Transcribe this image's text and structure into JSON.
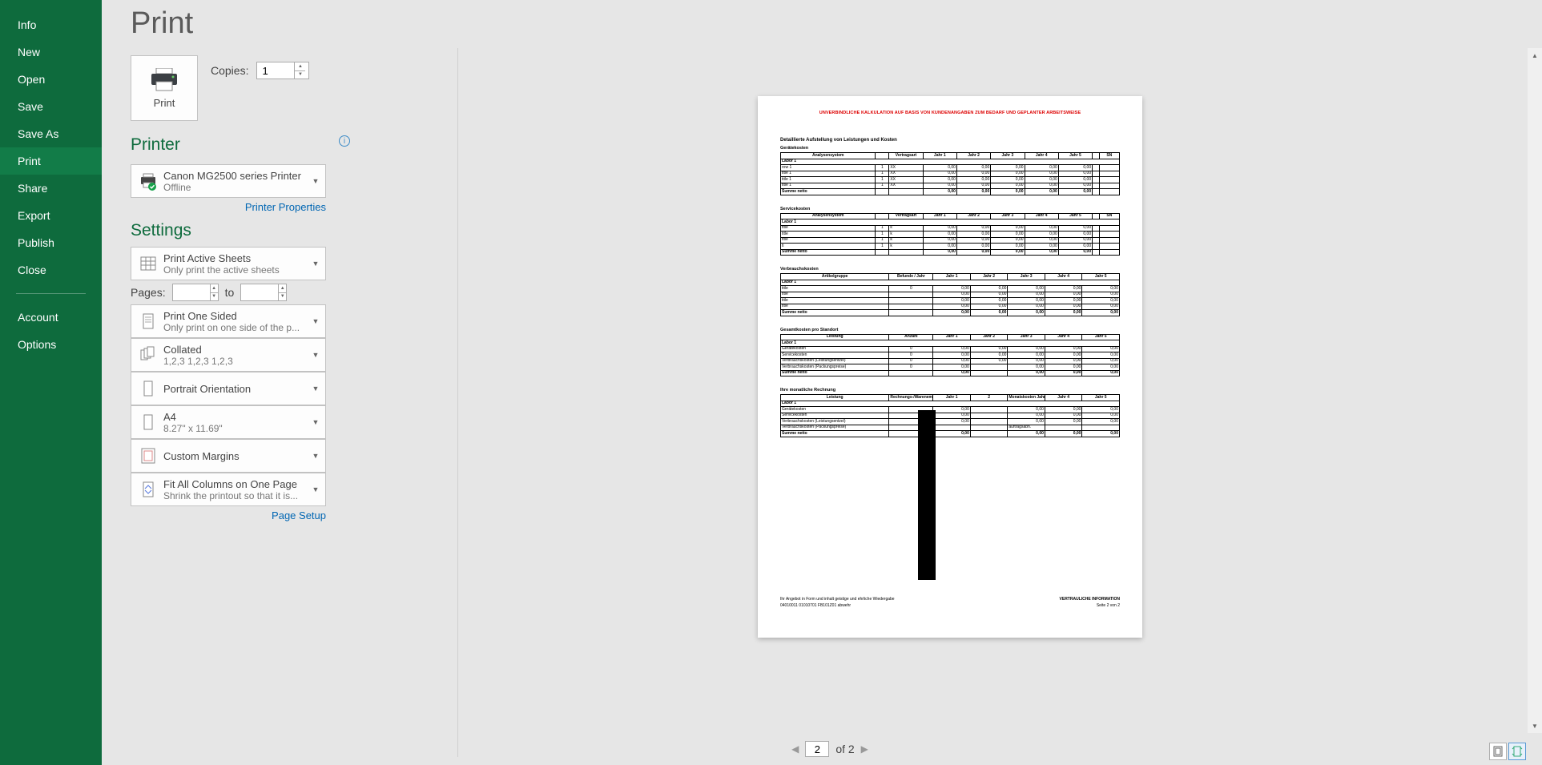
{
  "sidebar": {
    "items": [
      {
        "label": "Info"
      },
      {
        "label": "New"
      },
      {
        "label": "Open"
      },
      {
        "label": "Save"
      },
      {
        "label": "Save As"
      },
      {
        "label": "Print"
      },
      {
        "label": "Share"
      },
      {
        "label": "Export"
      },
      {
        "label": "Publish"
      },
      {
        "label": "Close"
      }
    ],
    "footer": [
      {
        "label": "Account"
      },
      {
        "label": "Options"
      }
    ]
  },
  "page_title": "Print",
  "print_button": "Print",
  "copies_label": "Copies:",
  "copies_value": "1",
  "printer_section": "Printer",
  "printer_name": "Canon MG2500 series Printer",
  "printer_status": "Offline",
  "printer_properties": "Printer Properties",
  "settings_section": "Settings",
  "settings": {
    "what": {
      "line1": "Print Active Sheets",
      "line2": "Only print the active sheets"
    },
    "pages_label": "Pages:",
    "pages_to": "to",
    "pages_from": "",
    "pages_to_val": "",
    "sided": {
      "line1": "Print One Sided",
      "line2": "Only print on one side of the p..."
    },
    "collate": {
      "line1": "Collated",
      "line2": "1,2,3    1,2,3    1,2,3"
    },
    "orientation": {
      "line1": "Portrait Orientation",
      "line2": ""
    },
    "paper": {
      "line1": "A4",
      "line2": "8.27\" x 11.69\""
    },
    "margins": {
      "line1": "Custom Margins",
      "line2": ""
    },
    "scaling": {
      "line1": "Fit All Columns on One Page",
      "line2": "Shrink the printout so that it is..."
    }
  },
  "page_setup": "Page Setup",
  "nav": {
    "current": "2",
    "total": "of 2"
  },
  "chart_data": {
    "type": "table",
    "title_red": "UNVERBINDLICHE KALKULATION AUF BASIS VON KUNDENANGABEN ZUM BEDARF UND GEPLANTER ARBEITSWEISE",
    "heading": "Detaillierte Aufstellung von Leistungen und Kosten",
    "sections": [
      {
        "name": "Gerätekosten",
        "columns": [
          "Analysensystem",
          "",
          "Vertragsart",
          "Jahr 1",
          "Jahr 2",
          "Jahr 3",
          "Jahr 4",
          "Jahr 5",
          "",
          "SN"
        ],
        "group": "Labor 1",
        "rows": [
          [
            "row 1",
            "1",
            "XX",
            "0,00",
            "0,00",
            "0,00",
            "0,00",
            "0,00",
            "",
            ""
          ],
          [
            "title 1",
            "1",
            "XX",
            "0,00",
            "0,00",
            "0,00",
            "0,00",
            "0,00",
            "",
            ""
          ],
          [
            "title 1",
            "1",
            "XX",
            "0,00",
            "0,00",
            "0,00",
            "0,00",
            "0,00",
            "",
            ""
          ],
          [
            "title 1",
            "1",
            "XX",
            "0,00",
            "0,00",
            "0,00",
            "0,00",
            "0,00",
            "",
            ""
          ]
        ],
        "sum": [
          "Summe netto",
          "",
          "",
          "0,00",
          "0,00",
          "0,00",
          "0,00",
          "0,00",
          "",
          ""
        ]
      },
      {
        "name": "Servicekosten",
        "columns": [
          "Analysensystem",
          "",
          "Vertragsart",
          "Jahr 1",
          "Jahr 2",
          "Jahr 3",
          "Jahr 4",
          "Jahr 5",
          "",
          "SN"
        ],
        "group": "Labor 1",
        "rows": [
          [
            "title",
            "1",
            "k",
            "0,00",
            "0,00",
            "0,00",
            "0,00",
            "0,00",
            "",
            ""
          ],
          [
            "title",
            "1",
            "k",
            "0,00",
            "0,00",
            "0,00",
            "0,00",
            "0,00",
            "",
            ""
          ],
          [
            "title",
            "1",
            "k",
            "0,00",
            "0,00",
            "0,00",
            "0,00",
            "0,00",
            "",
            ""
          ],
          [
            "ti",
            "1",
            "k",
            "0,00",
            "0,00",
            "0,00",
            "0,00",
            "0,00",
            "",
            ""
          ]
        ],
        "sum": [
          "Summe netto",
          "",
          "",
          "0,00",
          "0,00",
          "0,00",
          "0,00",
          "0,00",
          "",
          ""
        ]
      },
      {
        "name": "Verbrauchskosten",
        "columns": [
          "Artikelgruppe",
          "Befunde / Jahr",
          "Jahr 1",
          "Jahr 2",
          "Jahr 3",
          "Jahr 4",
          "Jahr 5"
        ],
        "group": "Labor 1",
        "rows": [
          [
            "title",
            "0",
            "0,00",
            "0,00",
            "0,00",
            "0,00",
            "0,00"
          ],
          [
            "title",
            "",
            "0,00",
            "0,00",
            "0,00",
            "0,00",
            "0,00"
          ],
          [
            "title",
            "",
            "0,00",
            "0,00",
            "0,00",
            "0,00",
            "0,00"
          ],
          [
            "title",
            "",
            "0,00",
            "0,00",
            "0,00",
            "0,00",
            "0,00"
          ]
        ],
        "sum": [
          "Summe netto",
          "",
          "0,00",
          "0,00",
          "0,00",
          "0,00",
          "0,00"
        ]
      },
      {
        "name": "Gesamtkosten pro Standort",
        "columns": [
          "Leistung",
          "Anzahl",
          "Jahr 1",
          "Jahr 2",
          "Jahr 3",
          "Jahr 4",
          "Jahr 5"
        ],
        "group": "Labor 1",
        "rows": [
          [
            "Gerätekosten",
            "0",
            "0,00",
            "0,00",
            "0,00",
            "0,00",
            "0,00"
          ],
          [
            "Servicekosten",
            "0",
            "0,00",
            "0,00",
            "0,00",
            "0,00",
            "0,00"
          ],
          [
            "Verbrauchskosten (Leistungsentzel)",
            "0",
            "0,00",
            "0,00",
            "0,00",
            "0,00",
            "0,00"
          ],
          [
            "Verbrauchskosten (Packungspreise)",
            "0",
            "0,00",
            "",
            "0,00",
            "0,00",
            "0,00"
          ]
        ],
        "sum": [
          "Summe netto",
          "",
          "0,00",
          "",
          "0,00",
          "0,00",
          "0,00"
        ]
      },
      {
        "name": "Ihre monatliche Rechnung",
        "columns": [
          "Leistung",
          "Rechnungs-/Warenempfang",
          "Jahr 1",
          "2",
          "Monatskosten Jahr 3",
          "Jahr 4",
          "Jahr 5"
        ],
        "group": "Labor 1",
        "rows": [
          [
            "Gerätekosten",
            "",
            "0,00",
            "",
            "0,00",
            "0,00",
            "0,00"
          ],
          [
            "Servicekosten",
            "",
            "0,00",
            "",
            "0,00",
            "0,00",
            "0,00"
          ],
          [
            "Verbrauchskosten (Leistungsentzel)",
            "",
            "0,00",
            "",
            "0,00",
            "0,00",
            "0,00"
          ],
          [
            "Verbrauchskosten (Packungspreise)",
            "",
            "",
            "",
            "auftragsabh.",
            "",
            ""
          ]
        ],
        "sum": [
          "Summe netto",
          "",
          "0,00",
          "",
          "0,00",
          "0,00",
          "0,00"
        ]
      }
    ],
    "footer_left": "Ihr Angebot in Form und inhalt geistige und ehrliche Wiedergabe",
    "footer_num": "04010011 01010701 FB101Z01 abwehr",
    "footer_right": "VERTRAULICHE INFORMATION",
    "footer_page": "Seite 2 von 2"
  }
}
